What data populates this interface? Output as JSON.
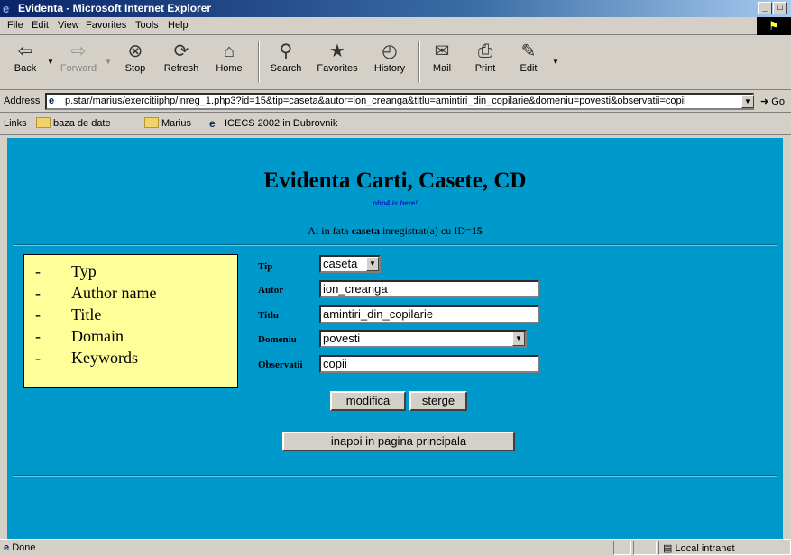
{
  "window": {
    "title": "Evidenta - Microsoft Internet Explorer",
    "minimize": "_",
    "maximize": "□"
  },
  "menu": {
    "items": [
      "File",
      "Edit",
      "View",
      "Favorites",
      "Tools",
      "Help"
    ]
  },
  "toolbar": {
    "back": "Back",
    "forward": "Forward",
    "stop": "Stop",
    "refresh": "Refresh",
    "home": "Home",
    "search": "Search",
    "favorites": "Favorites",
    "history": "History",
    "mail": "Mail",
    "print": "Print",
    "edit": "Edit"
  },
  "address": {
    "label": "Address",
    "url": "p.star/marius/exercitiiphp/inreg_1.php3?id=15&tip=caseta&autor=ion_creanga&titlu=amintiri_din_copilarie&domeniu=povesti&observatii=copii",
    "go": "Go"
  },
  "links": {
    "label": "Links",
    "items": [
      "baza de date",
      "Marius",
      "ICECS 2002 in Dubrovnik"
    ]
  },
  "page": {
    "title": "Evidenta Carti, Casete, CD",
    "php_note": "php4 is here!",
    "id_line_prefix": "Ai in fata",
    "id_line_type": "caseta",
    "id_line_mid": "inregistrat(a) cu ID=",
    "id_value": "15"
  },
  "notes": [
    "Typ",
    "Author name",
    "Title",
    "Domain",
    "Keywords"
  ],
  "form": {
    "tip_label": "Tip",
    "tip_value": "caseta",
    "autor_label": "Autor",
    "autor_value": "ion_creanga",
    "titlu_label": "Titlu",
    "titlu_value": "amintiri_din_copilarie",
    "domeniu_label": "Domeniu",
    "domeniu_value": "povesti",
    "observatii_label": "Observatii",
    "observatii_value": "copii",
    "modify_button": "modifica",
    "delete_button": "sterge",
    "back_button": "inapoi in pagina principala"
  },
  "status": {
    "text": "Done",
    "zone": "Local intranet"
  }
}
